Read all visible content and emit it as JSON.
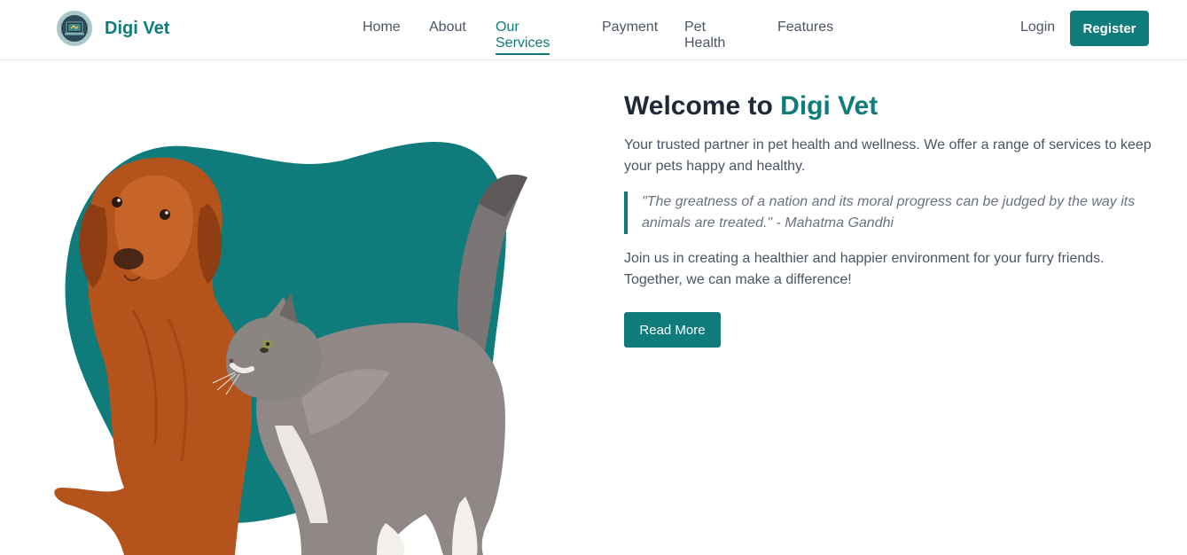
{
  "brand": {
    "name": "Digi Vet",
    "logo_icon": "laptop-paw-icon"
  },
  "nav": {
    "items": [
      {
        "label": "Home"
      },
      {
        "label": "About"
      },
      {
        "label": "Our Services",
        "active": true
      },
      {
        "label": "Payment"
      },
      {
        "label": "Pet Health"
      },
      {
        "label": "Features"
      }
    ]
  },
  "auth": {
    "login_label": "Login",
    "register_label": "Register"
  },
  "hero": {
    "headline_prefix": "Welcome to ",
    "headline_brand": "Digi Vet",
    "intro": "Your trusted partner in pet health and wellness. We offer a range of services to keep your pets happy and healthy.",
    "quote": "\"The greatness of a nation and its moral progress can be judged by the way its animals are treated.\" - Mahatma Gandhi",
    "join": "Join us in creating a healthier and happier environment for your furry friends. Together, we can make a difference!",
    "cta_label": "Read More"
  },
  "colors": {
    "accent": "#0f7b7b",
    "heading": "#1f2937",
    "body_text": "#4b5563"
  }
}
